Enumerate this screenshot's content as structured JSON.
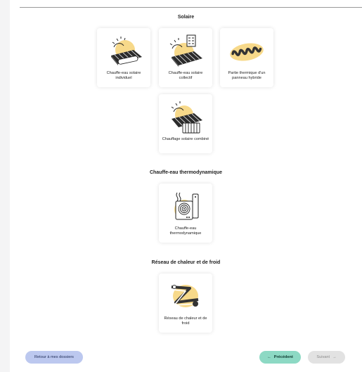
{
  "sections": [
    {
      "title": "Solaire",
      "cards": [
        {
          "label": "Chauffe-eau solaire individuel",
          "icon": "solar-panel-tank-icon"
        },
        {
          "label": "Chauffe-eau solaire collectif",
          "icon": "solar-panel-building-icon"
        },
        {
          "label": "Partie thermique d'un panneau hybride",
          "icon": "hybrid-panel-coil-icon"
        },
        {
          "label": "Chauffage solaire combiné",
          "icon": "solar-panel-radiator-icon"
        }
      ]
    },
    {
      "title": "Chauffe-eau thermodynamique",
      "cards": [
        {
          "label": "Chauffe-eau thermodynamique",
          "icon": "heat-pump-water-heater-icon"
        }
      ]
    },
    {
      "title": "Réseau de chaleur et de froid",
      "cards": [
        {
          "label": "Réseau de chaleur et de froid",
          "icon": "heating-network-pipes-icon"
        }
      ]
    }
  ],
  "footer": {
    "back_label": "Retour à mes dossiers",
    "prev_label": "Précédent",
    "next_label": "Suivant",
    "prev_icon": "arrow-left-icon",
    "next_icon": "arrow-right-icon"
  },
  "colors": {
    "accent_yellow": "#f7d98a",
    "back_button": "#bcc8ef",
    "prev_button": "#8dd9c4",
    "next_button_disabled": "#e2e2e2"
  }
}
